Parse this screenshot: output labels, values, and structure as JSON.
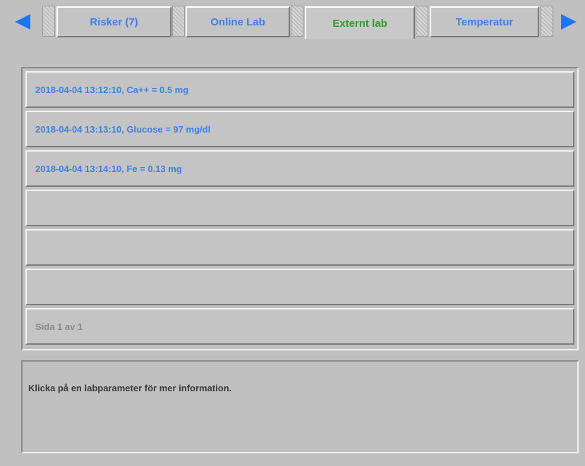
{
  "tabs": [
    {
      "label": "Risker (7)",
      "active": false
    },
    {
      "label": "Online Lab",
      "active": false
    },
    {
      "label": "Externt lab",
      "active": true
    },
    {
      "label": "Temperatur",
      "active": false
    }
  ],
  "lab_list": {
    "entries": [
      "2018-04-04 13:12:10, Ca++ = 0.5 mg",
      "2018-04-04 13:13:10, Glucose = 97 mg/dl",
      "2018-04-04 13:14:10, Fe = 0.13 mg",
      "",
      "",
      ""
    ],
    "pager": "Sida 1 av 1"
  },
  "info": {
    "message": "Klicka på en labparameter för mer information."
  },
  "colors": {
    "background": "#c0c0c0",
    "link_blue": "#3d7fe6",
    "active_tab_green": "#2f9a2f",
    "arrow_blue": "#1e73ff",
    "muted_text": "#8a8a8a"
  },
  "icons": {
    "left": "arrow-left-icon",
    "right": "arrow-right-icon"
  }
}
